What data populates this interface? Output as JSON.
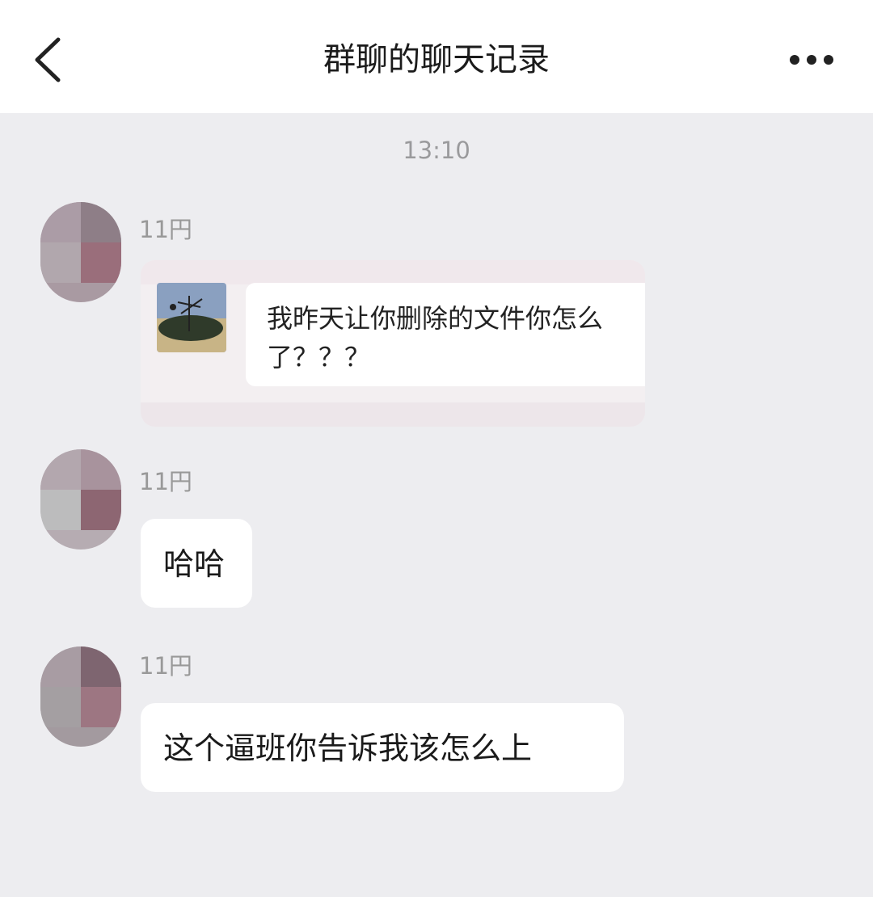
{
  "header": {
    "title": "群聊的聊天记录",
    "back_icon": "chevron-left-icon",
    "more_icon": "ellipsis-icon"
  },
  "chat": {
    "timestamp": "13:10",
    "messages": [
      {
        "sender": "11円",
        "type": "image",
        "quoted_line1": "我昨天让你删除的文件你怎么",
        "quoted_line2": "了？？？"
      },
      {
        "sender": "11円",
        "type": "text",
        "text": "哈哈"
      },
      {
        "sender": "11円",
        "type": "text",
        "text": "这个逼班你告诉我该怎么上"
      }
    ]
  },
  "colors": {
    "background": "#ededf0",
    "header_bg": "#ffffff",
    "bubble_bg": "#ffffff",
    "muted_text": "#999999"
  }
}
